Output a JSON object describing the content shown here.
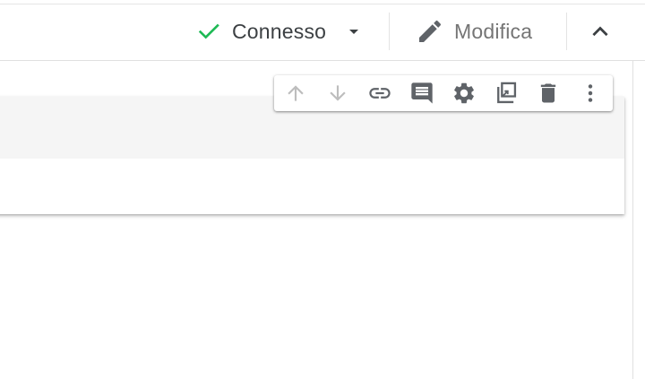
{
  "header": {
    "status": {
      "label": "Connesso",
      "icon": "check-icon",
      "color": "#1db954"
    },
    "edit": {
      "label": "Modifica",
      "icon": "pencil-icon"
    },
    "collapse_icon": "chevron-up-icon"
  },
  "toolbar": {
    "items": [
      {
        "name": "move-up",
        "icon": "arrow-up-icon",
        "enabled": false
      },
      {
        "name": "move-down",
        "icon": "arrow-down-icon",
        "enabled": false
      },
      {
        "name": "link",
        "icon": "link-icon",
        "enabled": true
      },
      {
        "name": "comment",
        "icon": "comment-icon",
        "enabled": true
      },
      {
        "name": "settings",
        "icon": "gear-icon",
        "enabled": true
      },
      {
        "name": "duplicate",
        "icon": "duplicate-icon",
        "enabled": true
      },
      {
        "name": "delete",
        "icon": "trash-icon",
        "enabled": true
      },
      {
        "name": "more",
        "icon": "more-vertical-icon",
        "enabled": true
      }
    ]
  },
  "colors": {
    "icon": "#5f6368",
    "icon_disabled": "#bdbdbd",
    "connected": "#1db954"
  }
}
